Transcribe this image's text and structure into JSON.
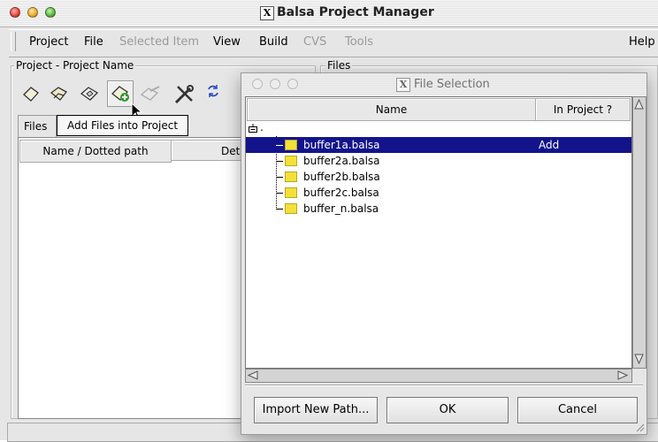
{
  "main_window": {
    "title": "Balsa Project Manager",
    "menu": {
      "project": "Project",
      "file": "File",
      "selected_item": "Selected Item",
      "view": "View",
      "build": "Build",
      "cvs": "CVS",
      "tools": "Tools",
      "help": "Help"
    },
    "project_frame_label": "Project - Project Name",
    "files_frame_label": "Files",
    "tabs": {
      "files": "Files"
    },
    "columns": {
      "name": "Name / Dotted path",
      "details": "Deta"
    },
    "tooltip": "Add Files into Project",
    "toolbar_icons": [
      "new-project-icon",
      "open-project-icon",
      "save-project-icon",
      "add-files-icon",
      "remove-icon",
      "tools-icon",
      "refresh-icon"
    ]
  },
  "dialog": {
    "title": "File Selection",
    "columns": {
      "name": "Name",
      "in_project": "In Project ?"
    },
    "root": ".",
    "files": [
      {
        "name": "buffer1a.balsa",
        "in_project": "Add",
        "selected": true
      },
      {
        "name": "buffer2a.balsa",
        "in_project": "",
        "selected": false
      },
      {
        "name": "buffer2b.balsa",
        "in_project": "",
        "selected": false
      },
      {
        "name": "buffer2c.balsa",
        "in_project": "",
        "selected": false
      },
      {
        "name": "buffer_n.balsa",
        "in_project": "",
        "selected": false
      }
    ],
    "buttons": {
      "import": "Import New Path...",
      "ok": "OK",
      "cancel": "Cancel"
    }
  },
  "colors": {
    "selection": "#13148c",
    "file_icon": "#f1e13a"
  }
}
